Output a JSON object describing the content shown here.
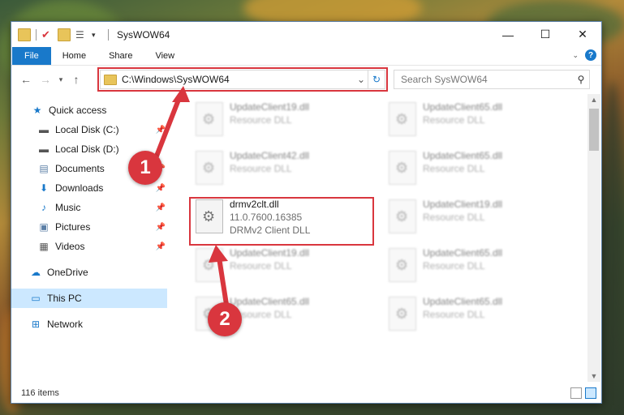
{
  "window": {
    "title": "SysWOW64"
  },
  "ribbon": {
    "tabs": [
      "File",
      "Home",
      "Share",
      "View"
    ]
  },
  "address": {
    "path": "C:\\Windows\\SysWOW64"
  },
  "search": {
    "placeholder": "Search SysWOW64"
  },
  "sidebar": {
    "items": [
      {
        "label": "Quick access",
        "icon": "star-icon",
        "pinned": false
      },
      {
        "label": "Local Disk (C:)",
        "icon": "drive-icon",
        "pinned": true
      },
      {
        "label": "Local Disk (D:)",
        "icon": "drive-icon",
        "pinned": false
      },
      {
        "label": "Documents",
        "icon": "documents-icon",
        "pinned": true
      },
      {
        "label": "Downloads",
        "icon": "download-icon",
        "pinned": true
      },
      {
        "label": "Music",
        "icon": "music-icon",
        "pinned": true
      },
      {
        "label": "Pictures",
        "icon": "pictures-icon",
        "pinned": true
      },
      {
        "label": "Videos",
        "icon": "videos-icon",
        "pinned": true
      },
      {
        "label": "OneDrive",
        "icon": "cloud-icon",
        "pinned": false
      },
      {
        "label": "This PC",
        "icon": "computer-icon",
        "pinned": false,
        "selected": true
      },
      {
        "label": "Network",
        "icon": "network-icon",
        "pinned": false
      }
    ]
  },
  "files": [
    {
      "name": "UpdateClient19.dll",
      "type": "Resource DLL"
    },
    {
      "name": "UpdateClient65.dll",
      "type": "Resource DLL"
    },
    {
      "name": "UpdateClient42.dll",
      "type": "Resource DLL"
    },
    {
      "name": "UpdateClient65.dll",
      "type": "Resource DLL"
    },
    {
      "name": "drmv2clt.dll",
      "version": "11.0.7600.16385",
      "type": "DRMv2 Client DLL"
    },
    {
      "name": "UpdateClient19.dll",
      "type": "Resource DLL"
    },
    {
      "name": "UpdateClient19.dll",
      "type": "Resource DLL"
    },
    {
      "name": "UpdateClient65.dll",
      "type": "Resource DLL"
    },
    {
      "name": "UpdateClient65.dll",
      "type": "Resource DLL"
    },
    {
      "name": "UpdateClient65.dll",
      "type": "Resource DLL"
    }
  ],
  "status": {
    "count": "116 items"
  },
  "callouts": [
    "1",
    "2"
  ],
  "colors": {
    "accent": "#1979ca",
    "highlight": "#d9363e",
    "selected": "#cce8ff"
  }
}
